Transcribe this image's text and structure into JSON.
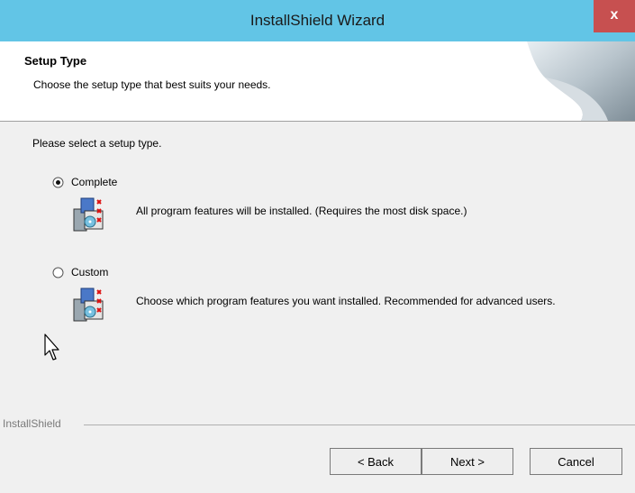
{
  "window": {
    "title": "InstallShield Wizard",
    "close_glyph": "x"
  },
  "header": {
    "title": "Setup Type",
    "subtitle": "Choose the setup type that best suits your needs."
  },
  "body": {
    "prompt": "Please select a setup type.",
    "options": [
      {
        "label": "Complete",
        "description": "All program features will be installed. (Requires the most disk space.)",
        "selected": true,
        "icon": "install-package-icon"
      },
      {
        "label": "Custom",
        "description": "Choose which program features you want installed. Recommended for advanced users.",
        "selected": false,
        "icon": "install-package-icon"
      }
    ]
  },
  "footer": {
    "brand": "InstallShield",
    "back_label": "< Back",
    "next_label": "Next >",
    "cancel_label": "Cancel"
  },
  "colors": {
    "titlebar": "#62c5e6",
    "close_button": "#c75050",
    "panel": "#f0f0f0"
  }
}
